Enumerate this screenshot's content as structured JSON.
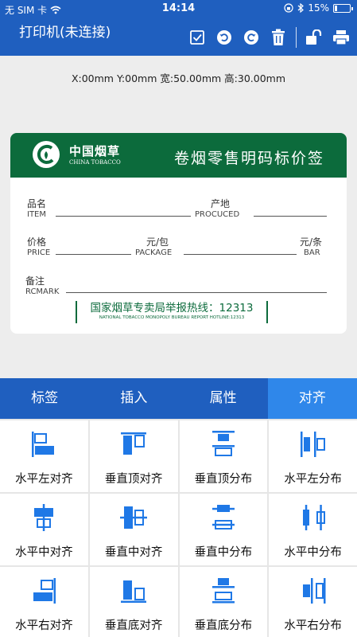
{
  "status_bar": {
    "carrier": "无 SIM 卡",
    "time": "14:14",
    "battery_text": "15%",
    "battery_level": 0.15
  },
  "nav": {
    "title": "打印机(未连接)"
  },
  "dimensions_text": "X:00mm  Y:00mm  宽:50.00mm  高:30.00mm",
  "label": {
    "logo_cn": "中国烟草",
    "logo_en": "CHINA TOBACCO",
    "title": "卷烟零售明码标价签",
    "fields": {
      "name_cn": "品名",
      "name_en": "ITEM",
      "origin_cn": "产地",
      "origin_en": "PROCUCED",
      "price_cn": "价格",
      "price_en": "PRICE",
      "package_cn": "元/包",
      "package_en": "PACKAGE",
      "bar_cn": "元/条",
      "bar_en": "BAR",
      "remark_cn": "备注",
      "remark_en": "RCMARK"
    },
    "hotline_cn": "国家烟草专卖局举报热线：12313",
    "hotline_en": "NATIONAL TOBACCO MONOPOLY BUREAU REPORT HOTLINE:12313"
  },
  "tabs": [
    "标签",
    "插入",
    "属性",
    "对齐"
  ],
  "active_tab": "对齐",
  "colors": {
    "primary": "#1f5fbf",
    "active_tab": "#2f87ea",
    "icon": "#1f78e6",
    "label_green": "#0c6b3c"
  },
  "align_buttons": [
    {
      "label": "水平左对齐",
      "icon": "align-left-icon"
    },
    {
      "label": "垂直顶对齐",
      "icon": "align-top-icon"
    },
    {
      "label": "垂直顶分布",
      "icon": "distribute-top-icon"
    },
    {
      "label": "水平左分布",
      "icon": "distribute-left-icon"
    },
    {
      "label": "水平中对齐",
      "icon": "align-horizontal-center-icon"
    },
    {
      "label": "垂直中对齐",
      "icon": "align-vertical-center-icon"
    },
    {
      "label": "垂直中分布",
      "icon": "distribute-vertical-center-icon"
    },
    {
      "label": "水平中分布",
      "icon": "distribute-horizontal-center-icon"
    },
    {
      "label": "水平右对齐",
      "icon": "align-right-icon"
    },
    {
      "label": "垂直底对齐",
      "icon": "align-bottom-icon"
    },
    {
      "label": "垂直底分布",
      "icon": "distribute-bottom-icon"
    },
    {
      "label": "水平右分布",
      "icon": "distribute-right-icon"
    }
  ]
}
